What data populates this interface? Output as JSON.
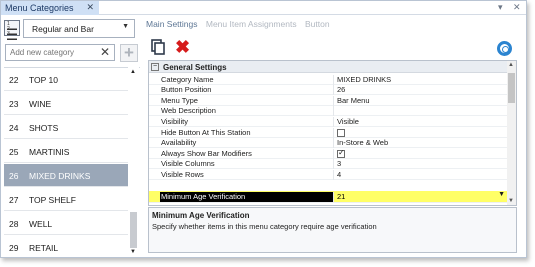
{
  "window": {
    "tab_title": "Menu Categories",
    "close_glyph": "✕",
    "pin_glyph": "▾",
    "close_window_glyph": "✕"
  },
  "left": {
    "filter_select": "Regular and Bar",
    "new_category_placeholder": "Add new category",
    "categories": [
      {
        "num": "22",
        "name": "TOP 10"
      },
      {
        "num": "23",
        "name": "WINE"
      },
      {
        "num": "24",
        "name": "SHOTS"
      },
      {
        "num": "25",
        "name": "MARTINIS"
      },
      {
        "num": "26",
        "name": "MIXED DRINKS",
        "selected": true
      },
      {
        "num": "27",
        "name": "TOP SHELF"
      },
      {
        "num": "28",
        "name": "WELL"
      },
      {
        "num": "29",
        "name": "RETAIL"
      }
    ]
  },
  "right": {
    "tabs": [
      "Main Settings",
      "Menu Item Assignments",
      "Button"
    ],
    "section_title": "General Settings",
    "properties": [
      {
        "label": "Category Name",
        "value": "MIXED DRINKS"
      },
      {
        "label": "Button Position",
        "value": "26"
      },
      {
        "label": "Menu Type",
        "value": "Bar Menu"
      },
      {
        "label": "Web Description",
        "value": ""
      },
      {
        "label": "Visibility",
        "value": "Visible"
      },
      {
        "label": "Hide Button At This Station",
        "value": "",
        "checkbox": false
      },
      {
        "label": "Availability",
        "value": "In-Store & Web"
      },
      {
        "label": "Always Show Bar Modifiers",
        "value": "",
        "checkbox": true
      },
      {
        "label": "Visible Columns",
        "value": "3"
      },
      {
        "label": "Visible Rows",
        "value": "4"
      },
      {
        "label": "Minimum Age Verification",
        "value": "21",
        "highlight": true
      }
    ],
    "description_title": "Minimum Age Verification",
    "description_text": "Specify whether items in this menu category require age verification"
  },
  "colors": {
    "selected_row": "#9aa7b8",
    "highlight": "#ffff66",
    "delete_red": "#d61c1c",
    "help_blue": "#2b84d0"
  }
}
